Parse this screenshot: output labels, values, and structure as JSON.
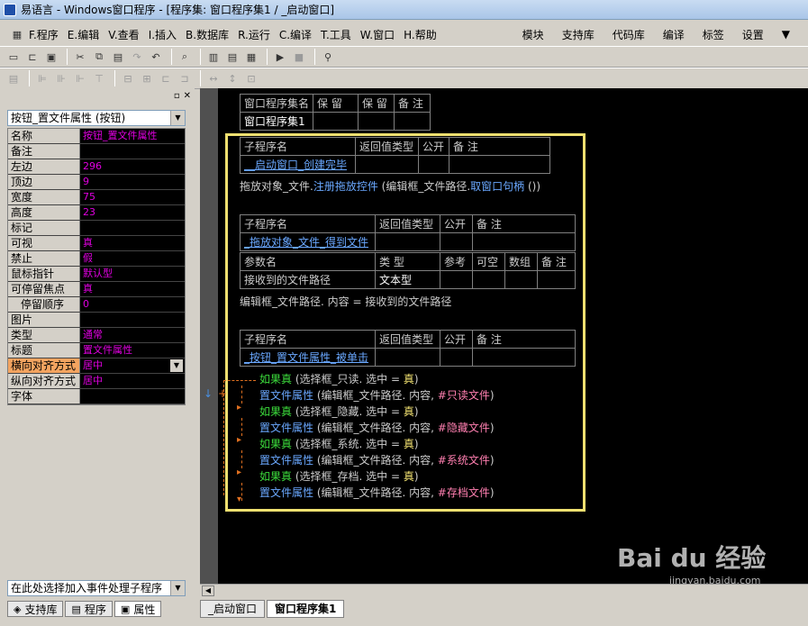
{
  "window": {
    "title": "易语言 - Windows窗口程序 - [程序集: 窗口程序集1 / _启动窗口]"
  },
  "menu": {
    "items": [
      "F.程序",
      "E.编辑",
      "V.查看",
      "I.插入",
      "B.数据库",
      "R.运行",
      "C.编译",
      "T.工具",
      "W.窗口",
      "H.帮助"
    ],
    "right": [
      "模块",
      "支持库",
      "代码库",
      "编译",
      "标签",
      "设置"
    ]
  },
  "left_panel": {
    "object_combo": "按钮_置文件属性 (按钮)",
    "event_combo": "在此处选择加入事件处理子程序",
    "props": [
      {
        "name": "名称",
        "value": "按钮_置文件属性"
      },
      {
        "name": "备注",
        "value": ""
      },
      {
        "name": "左边",
        "value": "296"
      },
      {
        "name": "顶边",
        "value": "9"
      },
      {
        "name": "宽度",
        "value": "75"
      },
      {
        "name": "高度",
        "value": "23"
      },
      {
        "name": "标记",
        "value": ""
      },
      {
        "name": "可视",
        "value": "真"
      },
      {
        "name": "禁止",
        "value": "假"
      },
      {
        "name": "鼠标指针",
        "value": "默认型"
      },
      {
        "name": "可停留焦点",
        "value": "真"
      },
      {
        "name": "停留顺序",
        "value": "0"
      },
      {
        "name": "图片",
        "value": ""
      },
      {
        "name": "类型",
        "value": "通常"
      },
      {
        "name": "标题",
        "value": "置文件属性"
      },
      {
        "name": "横向对齐方式",
        "value": "居中"
      },
      {
        "name": "纵向对齐方式",
        "value": "居中"
      },
      {
        "name": "字体",
        "value": ""
      }
    ],
    "tabs": [
      "支持库",
      "程序",
      "属性"
    ]
  },
  "editor": {
    "asm_header": [
      "窗口程序集名",
      "保 留",
      "保 留",
      "备 注"
    ],
    "asm_name": "窗口程序集1",
    "sub_header": [
      "子程序名",
      "返回值类型",
      "公开",
      "备 注"
    ],
    "sub1": "__启动窗口_创建完毕",
    "line1": {
      "obj": "拖放对象_文件.",
      "cmd": "注册拖放控件",
      "args": " (编辑框_文件路径.",
      "cmd2": "取窗口句柄",
      "tail": " ())"
    },
    "sub2": "_拖放对象_文件_得到文件",
    "param_header": [
      "参数名",
      "类 型",
      "参考",
      "可空",
      "数组",
      "备 注"
    ],
    "param_name": "接收到的文件路径",
    "param_type": "文本型",
    "line2": "编辑框_文件路径. 内容 = 接收到的文件路径",
    "sub3": "_按钮_置文件属性_被单击",
    "if_lines": [
      {
        "kw": "如果真",
        "cond": " (选择框_只读. 选中 = ",
        "v": "真",
        "tail": ")"
      },
      {
        "kw": "如果真",
        "cond": " (选择框_隐藏. 选中 = ",
        "v": "真",
        "tail": ")"
      },
      {
        "kw": "如果真",
        "cond": " (选择框_系统. 选中 = ",
        "v": "真",
        "tail": ")"
      },
      {
        "kw": "如果真",
        "cond": " (选择框_存档. 选中 = ",
        "v": "真",
        "tail": ")"
      }
    ],
    "set_lines": [
      {
        "cmd": "置文件属性",
        "args": " (编辑框_文件路径. 内容, ",
        "c": "#只读文件",
        "tail": ")"
      },
      {
        "cmd": "置文件属性",
        "args": " (编辑框_文件路径. 内容, ",
        "c": "#隐藏文件",
        "tail": ")"
      },
      {
        "cmd": "置文件属性",
        "args": " (编辑框_文件路径. 内容, ",
        "c": "#系统文件",
        "tail": ")"
      },
      {
        "cmd": "置文件属性",
        "args": " (编辑框_文件路径. 内容, ",
        "c": "#存档文件",
        "tail": ")"
      }
    ],
    "tabs": [
      "_启动窗口",
      "窗口程序集1"
    ]
  },
  "watermark": {
    "main": "Bai du 经验",
    "sub": "jingyan.baidu.com"
  }
}
